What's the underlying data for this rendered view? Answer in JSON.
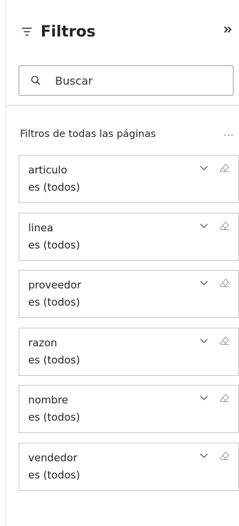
{
  "header": {
    "title": "Filtros",
    "collapse_icon": "double-chevron-right-icon"
  },
  "search": {
    "placeholder": "Buscar",
    "value": ""
  },
  "section": {
    "title": "Filtros de todas las páginas",
    "more": "..."
  },
  "filters": [
    {
      "name": "articulo",
      "value": "es (todos)"
    },
    {
      "name": "linea",
      "value": "es (todos)"
    },
    {
      "name": "proveedor",
      "value": "es (todos)"
    },
    {
      "name": "razon",
      "value": "es (todos)"
    },
    {
      "name": "nombre",
      "value": "es (todos)"
    },
    {
      "name": "vendedor",
      "value": "es (todos)"
    }
  ],
  "colors": {
    "text": "#252423",
    "border": "#c8c6c4",
    "icon": "#605e5c"
  }
}
